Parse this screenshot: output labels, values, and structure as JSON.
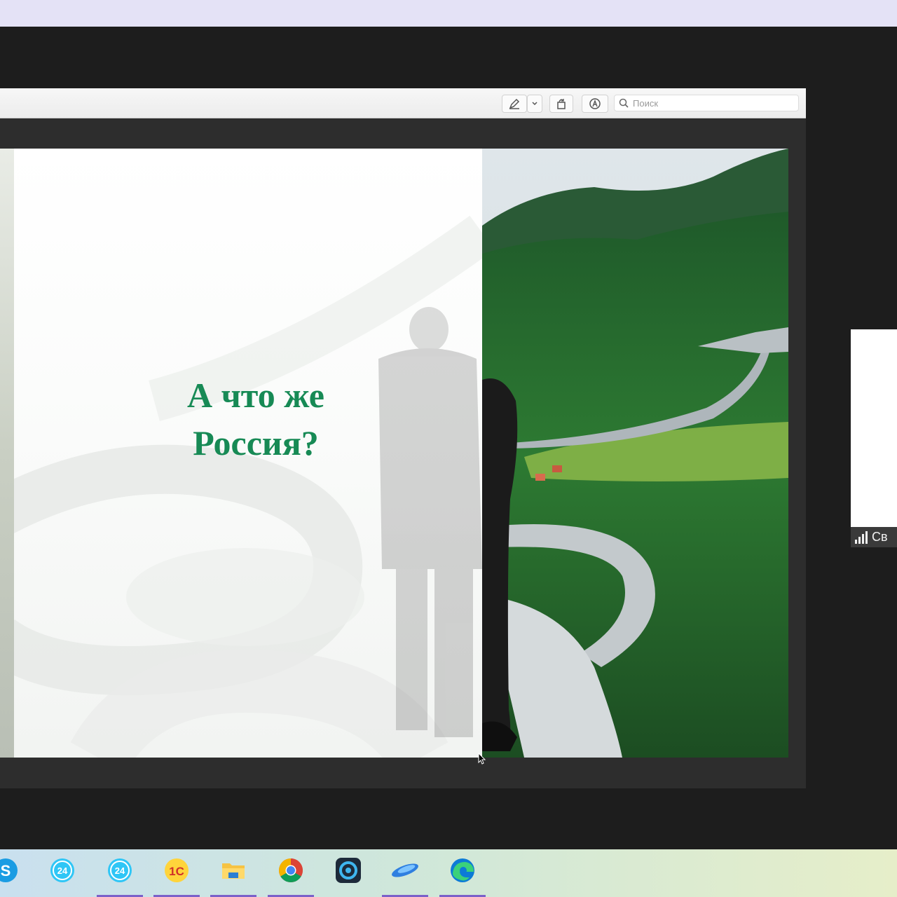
{
  "viewer": {
    "search": {
      "placeholder": "Поиск"
    }
  },
  "slide": {
    "title_line1": "А что же",
    "title_line2": "Россия?"
  },
  "participant": {
    "name_partial": "Св"
  },
  "taskbar": {
    "apps": [
      {
        "name": "skype-icon",
        "label": "S"
      },
      {
        "name": "bitrix24-icon",
        "label": "24"
      },
      {
        "name": "bitrix24-icon-2",
        "label": "24"
      },
      {
        "name": "1c-icon",
        "label": "1С"
      },
      {
        "name": "file-explorer-icon",
        "label": ""
      },
      {
        "name": "chrome-icon",
        "label": ""
      },
      {
        "name": "camera-app-icon",
        "label": ""
      },
      {
        "name": "blue-swoosh-app-icon",
        "label": ""
      },
      {
        "name": "edge-icon",
        "label": ""
      }
    ]
  },
  "colors": {
    "title_green": "#178a55",
    "taskbar_indicator": "#7b61c9"
  }
}
